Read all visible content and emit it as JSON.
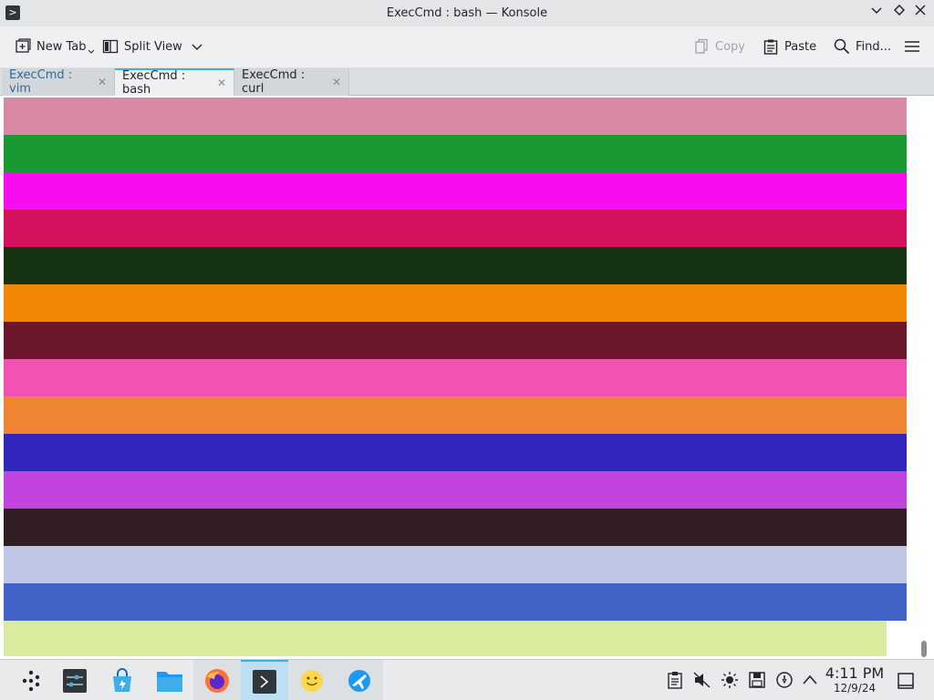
{
  "window": {
    "title": "ExecCmd : bash — Konsole",
    "app_icon": ">"
  },
  "toolbar": {
    "new_tab": "New Tab",
    "split_view": "Split View",
    "copy": "Copy",
    "paste": "Paste",
    "find": "Find..."
  },
  "tabs": [
    {
      "label": "ExecCmd : vim",
      "state": "inactive"
    },
    {
      "label": "ExecCmd : bash",
      "state": "active"
    },
    {
      "label": "ExecCmd : curl",
      "state": "inactive"
    }
  ],
  "terminal": {
    "bands": [
      "#d988a5",
      "#1a9831",
      "#f80cf0",
      "#d3115e",
      "#163414",
      "#f28706",
      "#6d172d",
      "#f152b3",
      "#ef8531",
      "#3127bf",
      "#c144e0",
      "#321d22",
      "#bfc7e6",
      "#4163c6",
      "#dcec9f"
    ]
  },
  "taskbar": {
    "time": "4:11 PM",
    "date": "12/9/24"
  },
  "colors": {
    "accent": "#3daee9"
  }
}
